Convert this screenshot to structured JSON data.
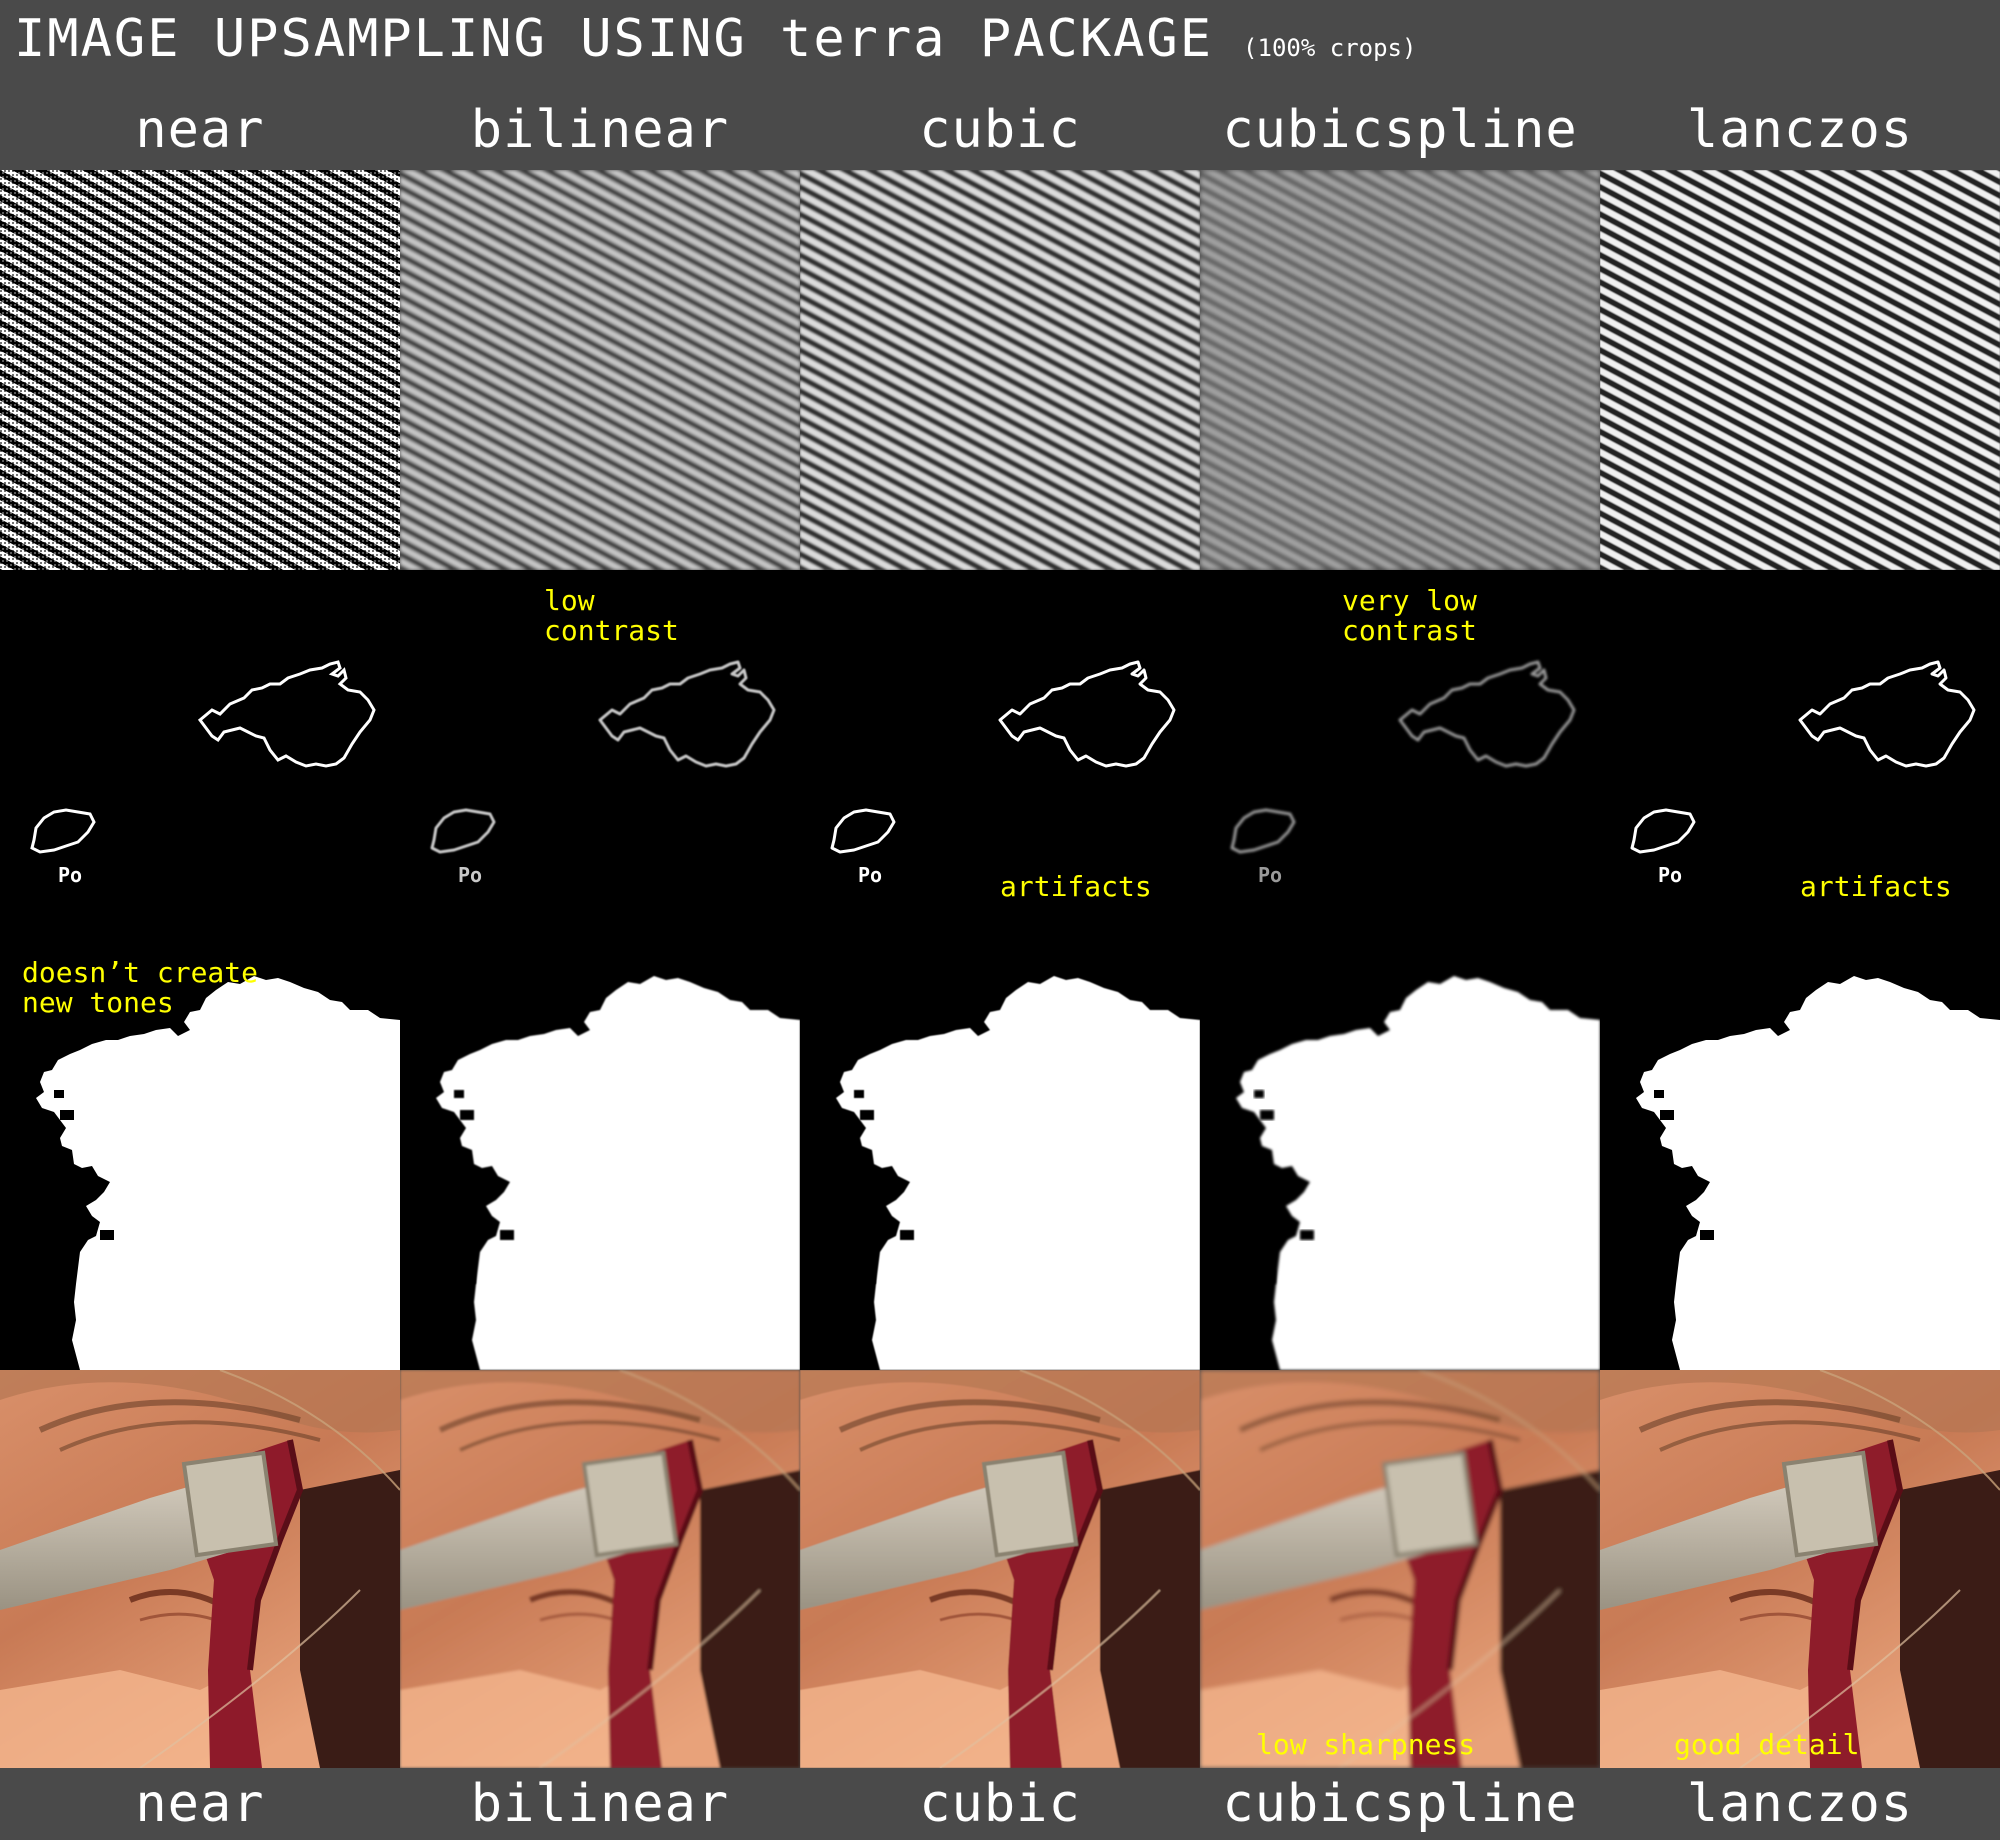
{
  "title": {
    "main": "IMAGE UPSAMPLING USING terra PACKAGE",
    "sub": "(100% crops)"
  },
  "methods": [
    "near",
    "bilinear",
    "cubic",
    "cubicspline",
    "lanczos"
  ],
  "labels": {
    "map_label": "Po"
  },
  "notes": {
    "bilinear_map": "low\ncontrast",
    "cubicspline_map": "very low\ncontrast",
    "cubic_map": "artifacts",
    "lanczos_map": "artifacts",
    "near_mask": "doesn’t create\nnew tones",
    "cubicspline_photo": "low sharpness",
    "lanczos_photo": "good detail"
  },
  "colors": {
    "background": "#4a4a4a",
    "annotation": "#ffff00",
    "text": "#ffffff"
  }
}
